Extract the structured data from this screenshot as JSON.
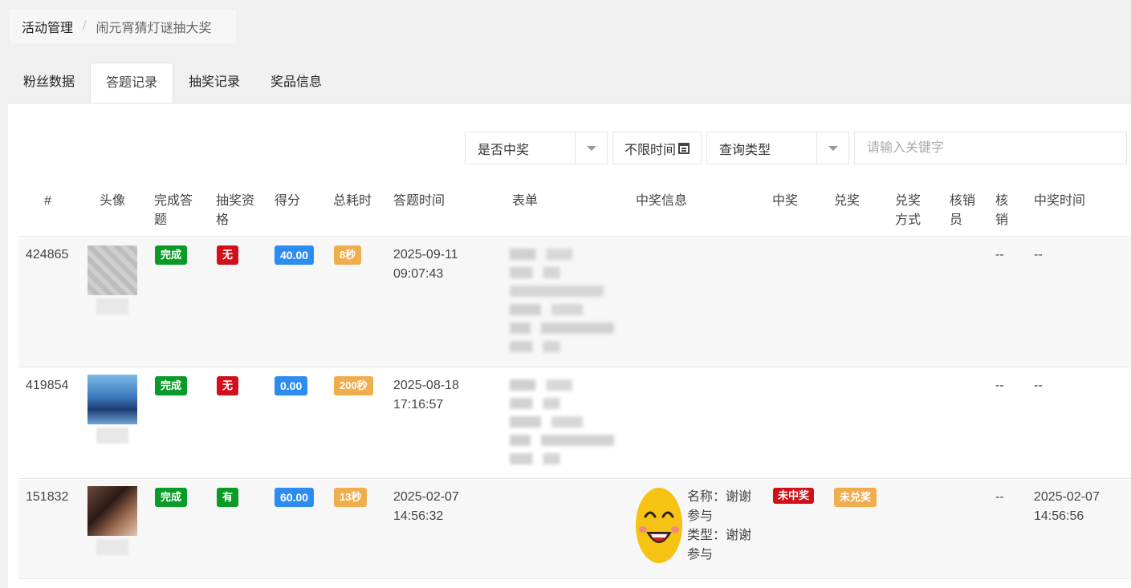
{
  "breadcrumb": {
    "root": "活动管理",
    "separator": "/",
    "current": "闹元宵猜灯谜抽大奖"
  },
  "tabs": [
    {
      "label": "粉丝数据"
    },
    {
      "label": "答题记录"
    },
    {
      "label": "抽奖记录"
    },
    {
      "label": "奖品信息"
    }
  ],
  "filters": {
    "winning_select": "是否中奖",
    "time_button": "不限时间",
    "query_type_select": "查询类型",
    "keyword_placeholder": "请输入关键字"
  },
  "table": {
    "headers": {
      "id": "#",
      "avatar": "头像",
      "completed": "完成答题",
      "eligible": "抽奖资格",
      "score": "得分",
      "duration": "总耗时",
      "answer_time": "答题时间",
      "form": "表单",
      "prize_info": "中奖信息",
      "won": "中奖",
      "redeem": "兑奖",
      "redeem_method": "兑奖方式",
      "verifier": "核销员",
      "verified": "核销",
      "win_time": "中奖时间"
    },
    "rows": [
      {
        "id": "424865",
        "completed": "完成",
        "eligible": "无",
        "score": "40.00",
        "duration": "8秒",
        "answer_date": "2025-09-11",
        "answer_clock": "09:07:43",
        "verified": "--",
        "win_time": "--"
      },
      {
        "id": "419854",
        "completed": "完成",
        "eligible": "无",
        "score": "0.00",
        "duration": "200秒",
        "answer_date": "2025-08-18",
        "answer_clock": "17:16:57",
        "verified": "--",
        "win_time": "--"
      },
      {
        "id": "151832",
        "completed": "完成",
        "eligible": "有",
        "score": "60.00",
        "duration": "13秒",
        "answer_date": "2025-02-07",
        "answer_clock": "14:56:32",
        "prize_name_label": "名称：",
        "prize_name_1": "谢谢",
        "prize_name_2": "参与",
        "prize_type_label": "类型：",
        "prize_type_1": "谢谢",
        "prize_type_2": "参与",
        "won": "未中奖",
        "redeem": "未兑奖",
        "verified": "--",
        "win_date": "2025-02-07",
        "win_clock": "14:56:56"
      }
    ]
  },
  "colors": {
    "green": "#0a9a27",
    "red": "#d0101a",
    "blue": "#2d8cf0",
    "orange": "#f0ad4e"
  }
}
